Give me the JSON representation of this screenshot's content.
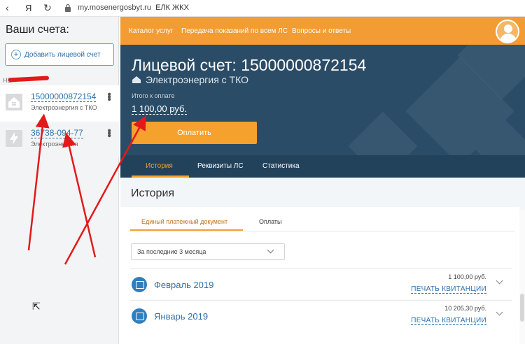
{
  "browser": {
    "back_glyph": "‹",
    "yandex_glyph": "Я",
    "reload_glyph": "↻",
    "url": "my.mosenergosbyt.ru",
    "title": "ЕЛК ЖКХ"
  },
  "sidebar": {
    "title": "Ваши счета:",
    "add_button": "Добавить лицевой счет",
    "section_label": "НЕ",
    "accounts": [
      {
        "number": "15000000872154",
        "service": "Электроэнергия с ТКО"
      },
      {
        "number": "36738-094-77",
        "service": "Электроэнергия"
      }
    ]
  },
  "topnav": {
    "items": [
      "Каталог услуг",
      "Передача показаний по всем ЛС",
      "Вопросы и ответы"
    ]
  },
  "hero": {
    "title": "Лицевой счет: 15000000872154",
    "subtitle": "Электроэнергия с ТКО",
    "due_label": "Итого к оплате",
    "due_amount": "1 100,00 руб.",
    "pay_button": "Оплатить",
    "tabs": [
      "История",
      "Реквизиты ЛС",
      "Статистика"
    ]
  },
  "history": {
    "heading": "История",
    "tabs": [
      "Единый платежный документ",
      "Оплаты"
    ],
    "period_select": "За последние 3 месяца",
    "rows": [
      {
        "month": "Февраль 2019",
        "amount": "1 100,00 руб.",
        "action": "ПЕЧАТЬ КВИТАНЦИИ"
      },
      {
        "month": "Январь 2019",
        "amount": "10 205,30 руб.",
        "action": "ПЕЧАТЬ КВИТАНЦИИ"
      }
    ]
  },
  "colors": {
    "accent_orange": "#f39c33",
    "hero_blue": "#2b4c66",
    "link_blue": "#2f6fa8",
    "annotation_red": "#e21a1a"
  }
}
